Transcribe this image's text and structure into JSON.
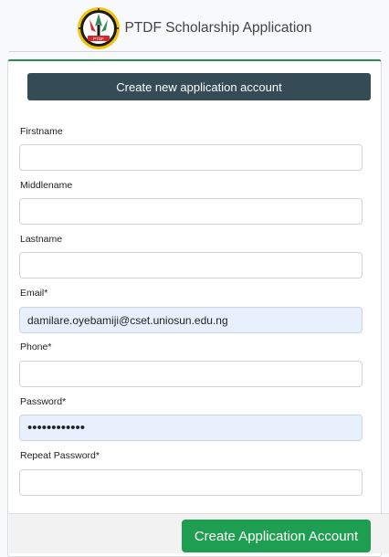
{
  "header": {
    "app_title": "PTDF Scholarship Application",
    "logo_icon": "ptdf-seal-icon",
    "logo_text": "PTDF"
  },
  "form": {
    "title": "Create new application account",
    "fields": [
      {
        "label": "Firstname",
        "value": "",
        "type": "text"
      },
      {
        "label": "Middlename",
        "value": "",
        "type": "text"
      },
      {
        "label": "Lastname",
        "value": "",
        "type": "text"
      },
      {
        "label": "Email*",
        "value": "damilare.oyebamiji@cset.uniosun.edu.ng",
        "type": "email"
      },
      {
        "label": "Phone*",
        "value": "",
        "type": "tel"
      },
      {
        "label": "Password*",
        "value": "............",
        "type": "password"
      },
      {
        "label": "Repeat Password*",
        "value": "",
        "type": "password"
      }
    ],
    "submit_label": "Create Application Account"
  },
  "colors": {
    "title_bar": "#354b56",
    "accent_green": "#1e9e50",
    "autofill_bg": "#e8f0fe"
  }
}
